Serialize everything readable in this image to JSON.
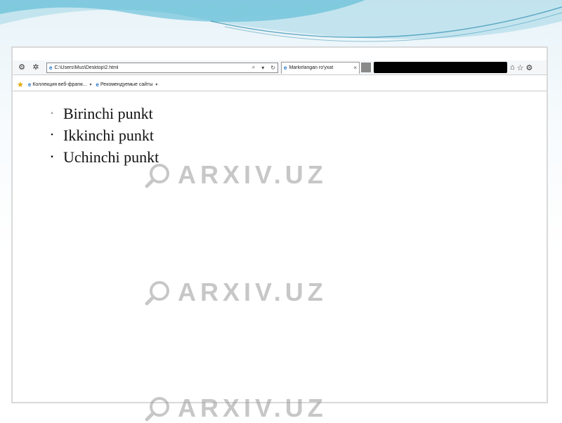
{
  "browser": {
    "address_url": "C:\\Users\\Mus\\Desktop\\2.html",
    "tab_title": "Markirlangan ro'yxat",
    "tab_close": "×",
    "favorites": [
      {
        "label": "Коллекция веб-фрагм..."
      },
      {
        "label": "Рекомендуемые сайты"
      }
    ]
  },
  "list": {
    "items": [
      {
        "label": "Birinchi punkt",
        "marker": "◦"
      },
      {
        "label": "Ikkinchi punkt",
        "marker": "•"
      },
      {
        "label": "Uchinchi punkt",
        "marker": "▪"
      }
    ]
  },
  "watermark": {
    "text": "ARXIV.UZ"
  },
  "colors": {
    "swoosh": "#3aa7c6",
    "frame_border": "#d9d9d9",
    "text": "#111111"
  }
}
